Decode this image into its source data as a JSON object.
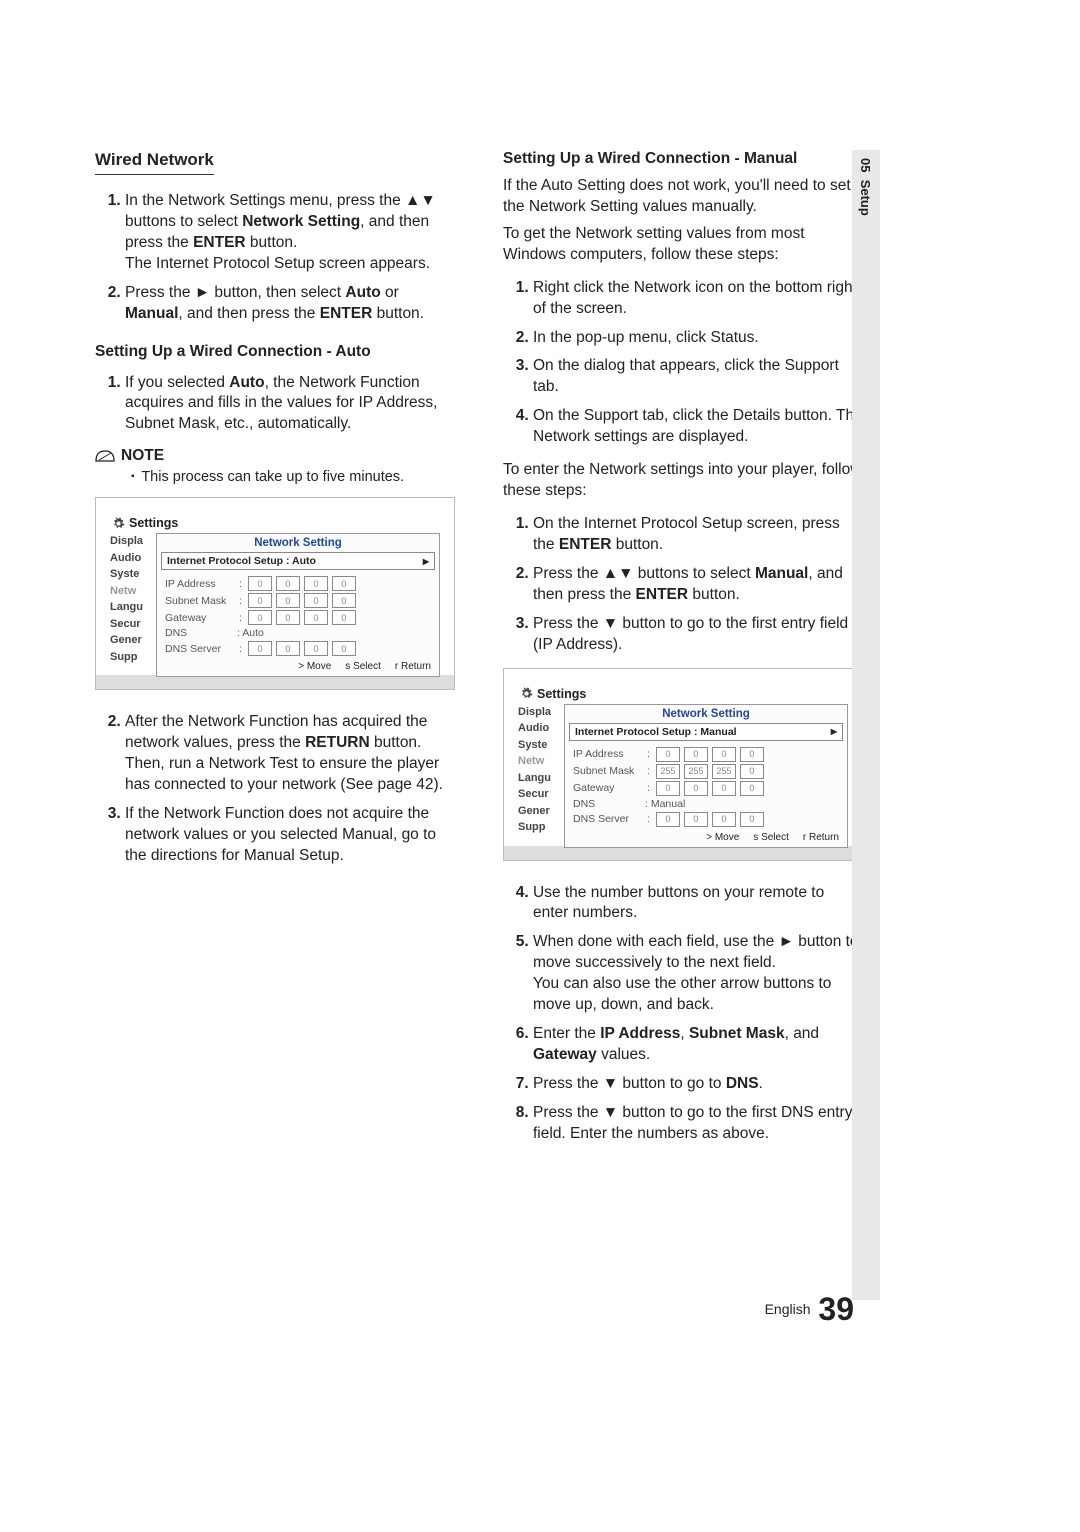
{
  "side_tab": {
    "chapter": "05",
    "title": "Setup"
  },
  "left": {
    "h2": "Wired Network",
    "intro_steps": [
      "In the Network Settings menu, press the ▲▼ buttons to select <b>Network Setting</b>, and then press the <b>ENTER</b> button.\nThe Internet Protocol Setup screen appears.",
      "Press the ► button, then select <b>Auto</b> or <b>Manual</b>, and then press the <b>ENTER</b> button."
    ],
    "sub_auto": "Setting Up a Wired Connection - Auto",
    "auto_steps_1": [
      "If you selected <b>Auto</b>, the Network Function acquires and fills in the values for IP Address, Subnet Mask, etc., automatically."
    ],
    "note_label": "NOTE",
    "note_body": "This process can take up to five minutes.",
    "auto_steps_2": [
      "After the Network Function has acquired the network values, press the <b>RETURN</b> button. Then, run a Network Test to ensure the player has connected to your network (See page 42).",
      "If the Network Function does not acquire the network values or you selected Manual, go to the directions for Manual Setup."
    ]
  },
  "right": {
    "sub_manual": "Setting Up a Wired Connection - Manual",
    "intro1": "If the Auto Setting does not work, you'll need to set the Network Setting values manually.",
    "intro2": "To get the Network setting values from most Windows computers, follow these steps:",
    "pc_steps": [
      "Right click the Network icon on the bottom right of the screen.",
      "In the pop-up menu, click Status.",
      "On the dialog that appears, click the Support tab.",
      "On the Support tab, click the Details button. The Network settings are displayed."
    ],
    "intro3": "To enter the Network settings into your player, follow these steps:",
    "enter_steps": [
      "On the Internet Protocol Setup screen, press the <b>ENTER</b> button.",
      "Press the ▲▼ buttons to select <b>Manual</b>, and then press the <b>ENTER</b> button.",
      "Press the ▼ button to go to the first entry field (IP Address)."
    ],
    "cont_steps": [
      "Use the number buttons on your remote to enter numbers.",
      "When done with each field, use the ► button to move successively to the next field.\nYou can also use the other arrow buttons to move up, down, and back.",
      "Enter the <b>IP Address</b>, <b>Subnet Mask</b>, and <b>Gateway</b> values.",
      "Press the ▼ button to go to <b>DNS</b>.",
      "Press the ▼ button to go to the first DNS entry field. Enter the numbers as above."
    ]
  },
  "osd": {
    "settings_label": "Settings",
    "nav": [
      "Displa",
      "Audio",
      "Syste",
      "Netw",
      "Langu",
      "Secur",
      "Gener",
      "Supp"
    ],
    "title": "Network Setting",
    "proto_label": "Internet Protocol Setup",
    "auto_mode": ": Auto",
    "manual_mode": ": Manual",
    "rows": {
      "ip": "IP Address",
      "subnet": "Subnet Mask",
      "gateway": "Gateway",
      "dns": "DNS",
      "dnsserver": "DNS Server"
    },
    "auto_vals": {
      "ip": [
        "0",
        "0",
        "0",
        "0"
      ],
      "subnet": [
        "0",
        "0",
        "0",
        "0"
      ],
      "gateway": [
        "0",
        "0",
        "0",
        "0"
      ],
      "dns_mode": ": Auto",
      "dnsserver": [
        "0",
        "0",
        "0",
        "0"
      ]
    },
    "manual_vals": {
      "ip": [
        "0",
        "0",
        "0",
        "0"
      ],
      "subnet": [
        "255",
        "255",
        "255",
        "0"
      ],
      "gateway": [
        "0",
        "0",
        "0",
        "0"
      ],
      "dns_mode": ": Manual",
      "dnsserver": [
        "0",
        "0",
        "0",
        "0"
      ]
    },
    "footer": {
      "move": "> Move",
      "select": "s Select",
      "return": "r Return"
    }
  },
  "footer": {
    "lang": "English",
    "page": "39"
  }
}
